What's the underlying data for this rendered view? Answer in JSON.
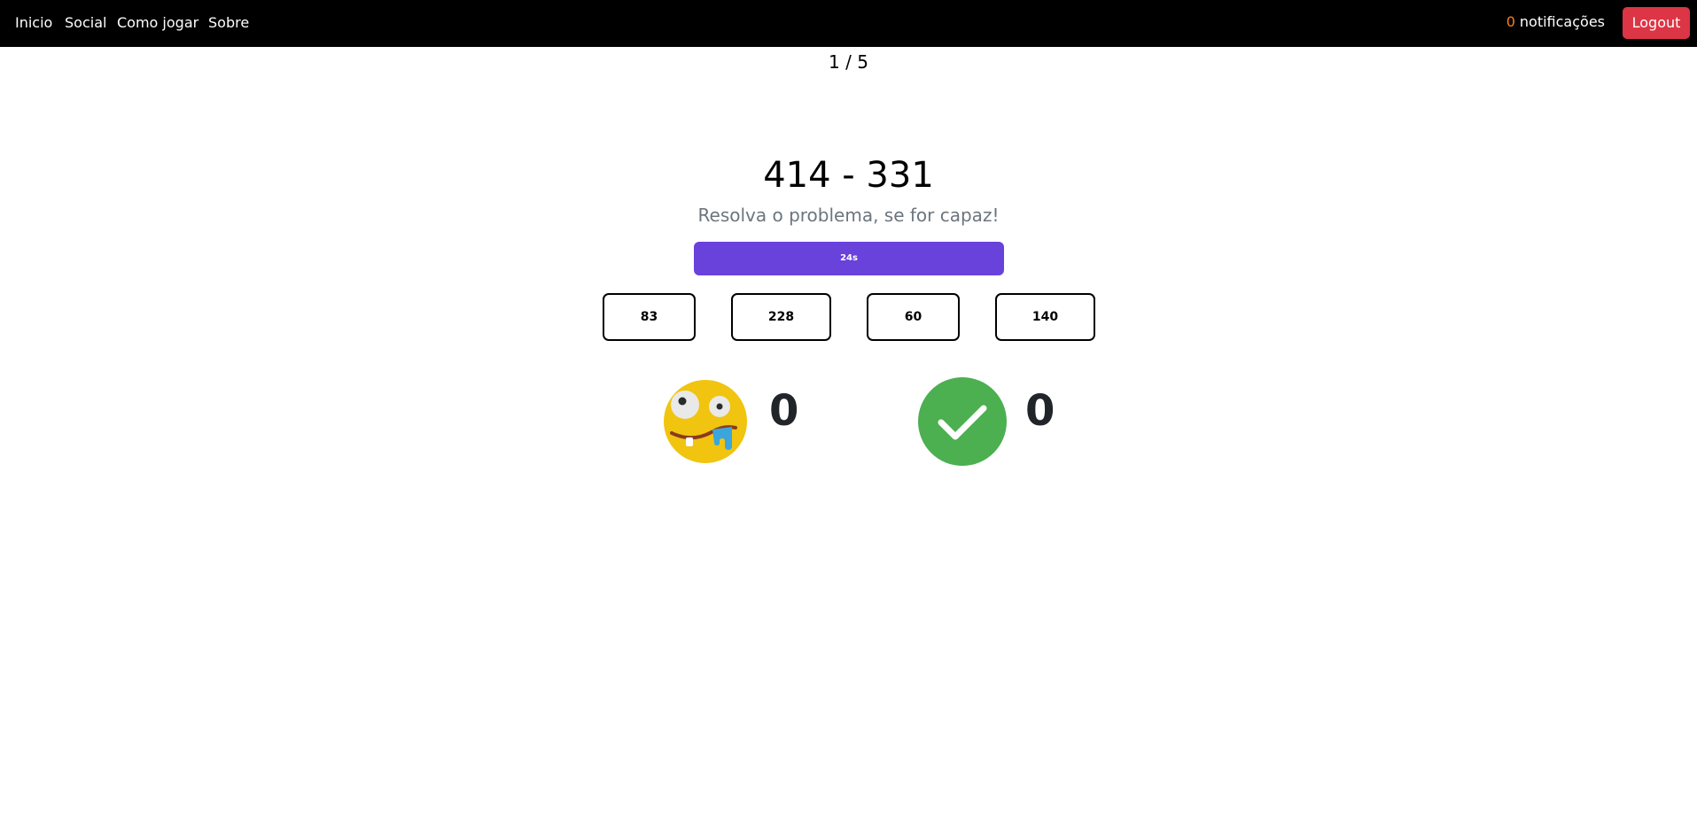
{
  "nav": {
    "links": [
      "Inicio",
      "Social",
      "Como jogar",
      "Sobre"
    ],
    "notifications_count": "0",
    "notifications_label": "notificações",
    "logout_label": "Logout"
  },
  "game": {
    "progress": "1 / 5",
    "problem": "414 - 331",
    "subtitle": "Resolva o problema, se for capaz!",
    "timer_label": "24s",
    "answers": [
      "83",
      "228",
      "60",
      "140"
    ],
    "wrong_count": "0",
    "right_count": "0"
  },
  "colors": {
    "navbar": "#000000",
    "logout": "#dc3545",
    "notification_count": "#fd7e14",
    "timer": "#6941db",
    "correct_icon": "#4caf50",
    "wrong_icon": "#f1c40f"
  },
  "icons": {
    "wrong": "silly-face-icon",
    "right": "check-circle-icon"
  }
}
